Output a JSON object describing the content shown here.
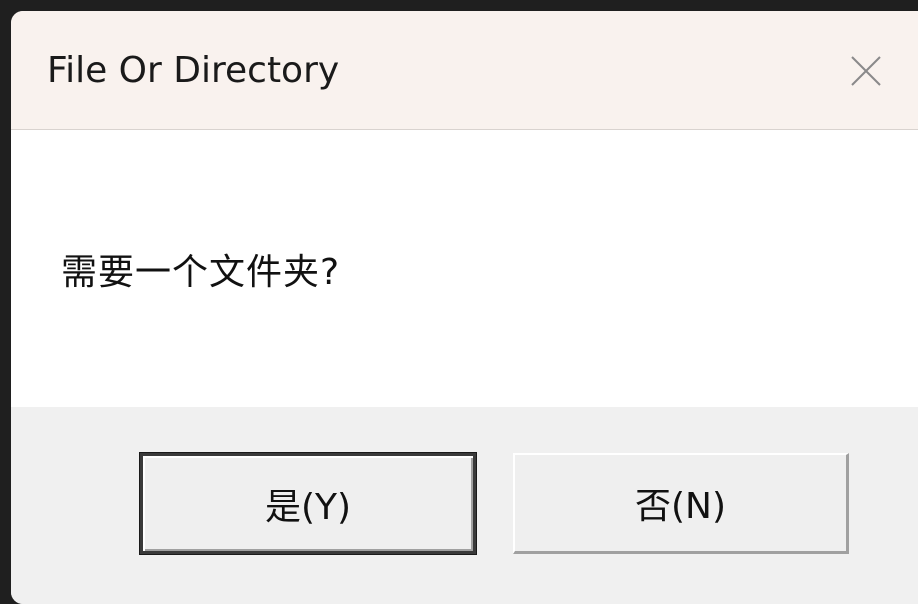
{
  "dialog": {
    "title": "File Or Directory",
    "close_icon": "close-icon",
    "message": "需要一个文件夹?",
    "buttons": {
      "yes_label": "是(Y)",
      "no_label": "否(N)"
    }
  },
  "colors": {
    "titlebar_bg": "#f9f2ee",
    "body_bg": "#ffffff",
    "footer_bg": "#f0f0f0"
  }
}
